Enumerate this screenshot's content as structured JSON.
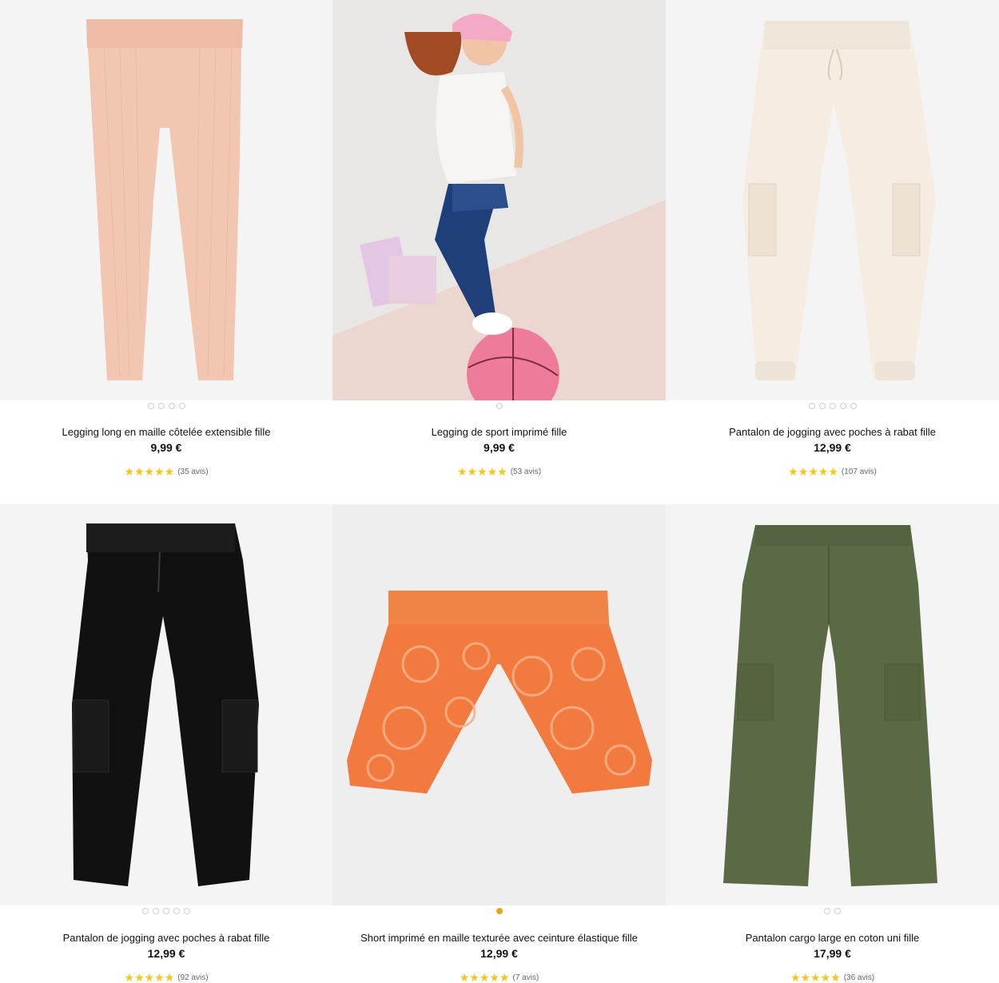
{
  "products": [
    {
      "title": "Legging long en maille côtelée extensible fille",
      "price": "9,99 €",
      "stars": "★★★★★",
      "reviews": "(35 avis)",
      "image": "pink-ribbed-legging"
    },
    {
      "title": "Legging de sport imprimé fille",
      "price": "9,99 €",
      "stars": "★★★★★",
      "reviews": "(53 avis)",
      "image": "girl-sport-legging-photo"
    },
    {
      "title": "Pantalon de jogging avec poches à rabat fille",
      "price": "12,99 €",
      "stars": "★★★★★",
      "reviews": "(107 avis)",
      "image": "cream-jogging-pants"
    },
    {
      "title": "Pantalon de jogging avec poches à rabat fille",
      "price": "12,99 €",
      "stars": "★★★★★",
      "reviews": "(92 avis)",
      "image": "black-cargo-jogging-pants"
    },
    {
      "title": "Short imprimé en maille texturée avec ceinture élastique fille",
      "price": "12,99 €",
      "stars": "★★★★★",
      "reviews": "(7 avis)",
      "image": "orange-printed-shorts"
    },
    {
      "title": "Pantalon cargo large en coton uni fille",
      "price": "17,99 €",
      "stars": "★★★★★",
      "reviews": "(36 avis)",
      "image": "khaki-cargo-pants"
    }
  ],
  "colors": {
    "star": "#f5c518",
    "dot_active": "#f1a11c",
    "dot": "#cfcfcf"
  }
}
